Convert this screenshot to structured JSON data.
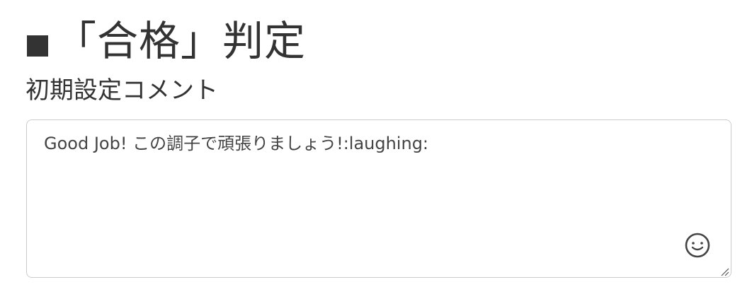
{
  "section": {
    "title": "「合格」判定",
    "title_marker": "■"
  },
  "comment": {
    "label": "初期設定コメント",
    "value": "Good Job! この調子で頑張りましょう!:laughing:"
  },
  "icons": {
    "emoji_button": "smiley-face-icon",
    "resize": "resize-handle-icon"
  },
  "colors": {
    "text": "#333333",
    "border": "#cccccc"
  }
}
